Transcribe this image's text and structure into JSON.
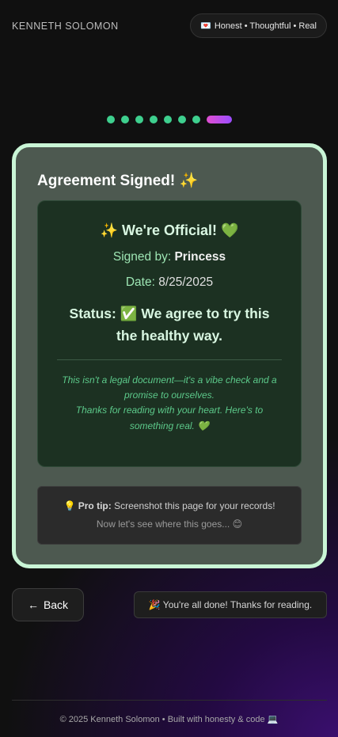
{
  "header": {
    "brand": "KENNETH SOLOMON",
    "tagline_icon": "💌",
    "tagline": "Honest • Thoughtful • Real"
  },
  "progress": {
    "completed_steps": 7,
    "current_step": 8,
    "total_steps": 8
  },
  "card": {
    "title": "Agreement Signed! ✨",
    "certificate": {
      "heading": "✨  We're Official! 💚",
      "signed_by_label": "Signed by:",
      "signed_by_value": "Princess",
      "date_label": "Date:",
      "date_value": "8/25/2025",
      "status_label": "Status:",
      "status_value": "✅ We agree to try this the healthy way.",
      "note_line1": "This isn't a legal document—it's a vibe check and a promise to ourselves.",
      "note_line2": "Thanks for reading with your heart. Here's to something real. 💚"
    },
    "tip": {
      "icon": "💡",
      "label": "Pro tip:",
      "text": "Screenshot this page for your records!",
      "subtext": "Now let's see where this goes... 😊"
    }
  },
  "nav": {
    "back_icon": "←",
    "back_label": "Back",
    "done_message": "🎉 You're all done! Thanks for reading."
  },
  "footer": {
    "text": "© 2025 Kenneth Solomon • Built with honesty & code 💻"
  },
  "colors": {
    "accent_green": "#3ecf8e",
    "active_step_gradient_start": "#e04fd0",
    "active_step_gradient_end": "#9b4dff",
    "card_border": "#c9f5d6"
  }
}
